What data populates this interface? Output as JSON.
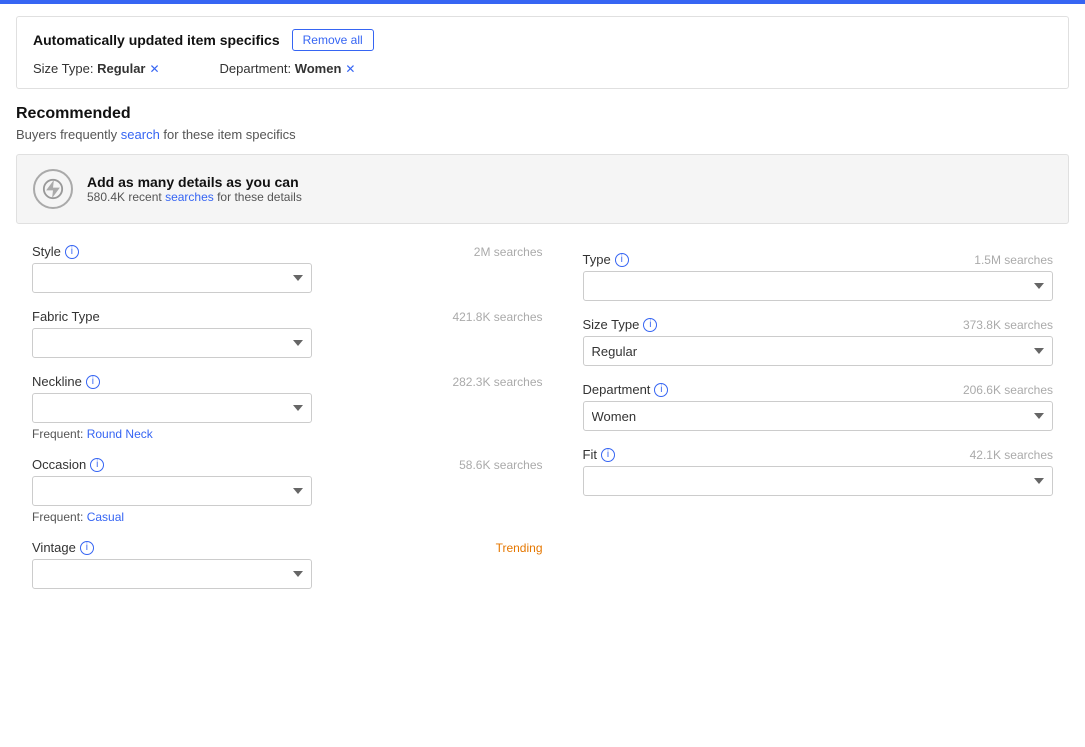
{
  "topBar": {},
  "autoUpdate": {
    "title": "Automatically updated item specifics",
    "removeAllLabel": "Remove all",
    "tags": [
      {
        "label": "Size Type:",
        "value": "Regular"
      },
      {
        "label": "Department:",
        "value": "Women"
      }
    ]
  },
  "recommended": {
    "title": "Recommended",
    "subtitle": "Buyers frequently search for these item specifics",
    "infoBanner": {
      "mainText": "Add as many details as you can",
      "subText": "580.4K recent searches for these details",
      "highlightWord": "searches"
    }
  },
  "fields": {
    "left": [
      {
        "id": "style",
        "label": "Style",
        "hasInfo": true,
        "searches": "2M searches",
        "trending": false,
        "value": "",
        "frequent": null
      },
      {
        "id": "fabric-type",
        "label": "Fabric Type",
        "hasInfo": false,
        "searches": "421.8K searches",
        "trending": false,
        "value": "",
        "frequent": null
      },
      {
        "id": "neckline",
        "label": "Neckline",
        "hasInfo": true,
        "searches": "282.3K searches",
        "trending": false,
        "value": "",
        "frequent": "Round Neck"
      },
      {
        "id": "occasion",
        "label": "Occasion",
        "hasInfo": true,
        "searches": "58.6K searches",
        "trending": false,
        "value": "",
        "frequent": "Casual"
      },
      {
        "id": "vintage",
        "label": "Vintage",
        "hasInfo": true,
        "searches": "Trending",
        "trending": true,
        "value": "",
        "frequent": null
      }
    ],
    "right": [
      {
        "id": "type",
        "label": "Type",
        "hasInfo": true,
        "searches": "1.5M searches",
        "trending": false,
        "value": "",
        "frequent": null
      },
      {
        "id": "size-type",
        "label": "Size Type",
        "hasInfo": true,
        "searches": "373.8K searches",
        "trending": false,
        "value": "Regular",
        "frequent": null
      },
      {
        "id": "department",
        "label": "Department",
        "hasInfo": true,
        "searches": "206.6K searches",
        "trending": false,
        "value": "Women",
        "frequent": null
      },
      {
        "id": "fit",
        "label": "Fit",
        "hasInfo": true,
        "searches": "42.1K searches",
        "trending": false,
        "value": "",
        "frequent": null
      }
    ]
  }
}
